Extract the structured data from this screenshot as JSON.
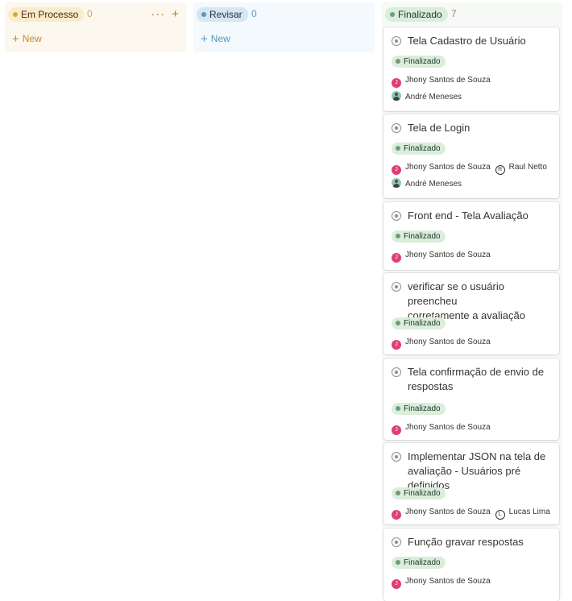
{
  "columns": [
    {
      "status": "Em Processo",
      "count": "0",
      "new_label": "New",
      "status_color": "#d9a441",
      "actions": [
        "more-icon",
        "plus-icon"
      ]
    },
    {
      "status": "Revisar",
      "count": "0",
      "new_label": "New",
      "status_color": "#5b97bd"
    },
    {
      "status": "Finalizado",
      "count": "7",
      "status_color": "#6c9b7d",
      "cards": [
        {
          "title_lines": [
            "Tela Cadastro de Usuário"
          ],
          "status": "Finalizado",
          "people_rows": [
            [
              "Jhony Santos de Souza"
            ],
            [
              "André Meneses"
            ]
          ]
        },
        {
          "title_lines": [
            "Tela de Login"
          ],
          "status": "Finalizado",
          "people_rows": [
            [
              "Jhony Santos de Souza",
              "Raul Netto"
            ],
            [
              "André Meneses"
            ]
          ]
        },
        {
          "title_lines": [
            "Front end  - Tela Avaliação"
          ],
          "status": "Finalizado",
          "people_rows": [
            [
              "Jhony Santos de Souza"
            ]
          ]
        },
        {
          "title_lines": [
            "verificar se o usuário preencheu",
            "corretamente a avaliação"
          ],
          "status": "Finalizado",
          "people_rows": [
            [
              "Jhony Santos de Souza"
            ]
          ]
        },
        {
          "title_lines": [
            "Tela confirmação de envio de",
            "respostas"
          ],
          "status": "Finalizado",
          "people_rows": [
            [
              "Jhony Santos de Souza"
            ]
          ]
        },
        {
          "title_lines": [
            "Implementar JSON na tela de",
            "avaliação - Usuários pré definidos"
          ],
          "status": "Finalizado",
          "people_rows": [
            [
              "Jhony Santos de Souza",
              "Lucas Lima"
            ]
          ]
        },
        {
          "title_lines": [
            "Função gravar respostas"
          ],
          "status": "Finalizado",
          "people_rows": [
            [
              "Jhony Santos de Souza"
            ]
          ]
        }
      ]
    }
  ],
  "avatars": {
    "Jhony Santos de Souza": "J",
    "Raul Netto": "R",
    "Lucas Lima": "L"
  }
}
